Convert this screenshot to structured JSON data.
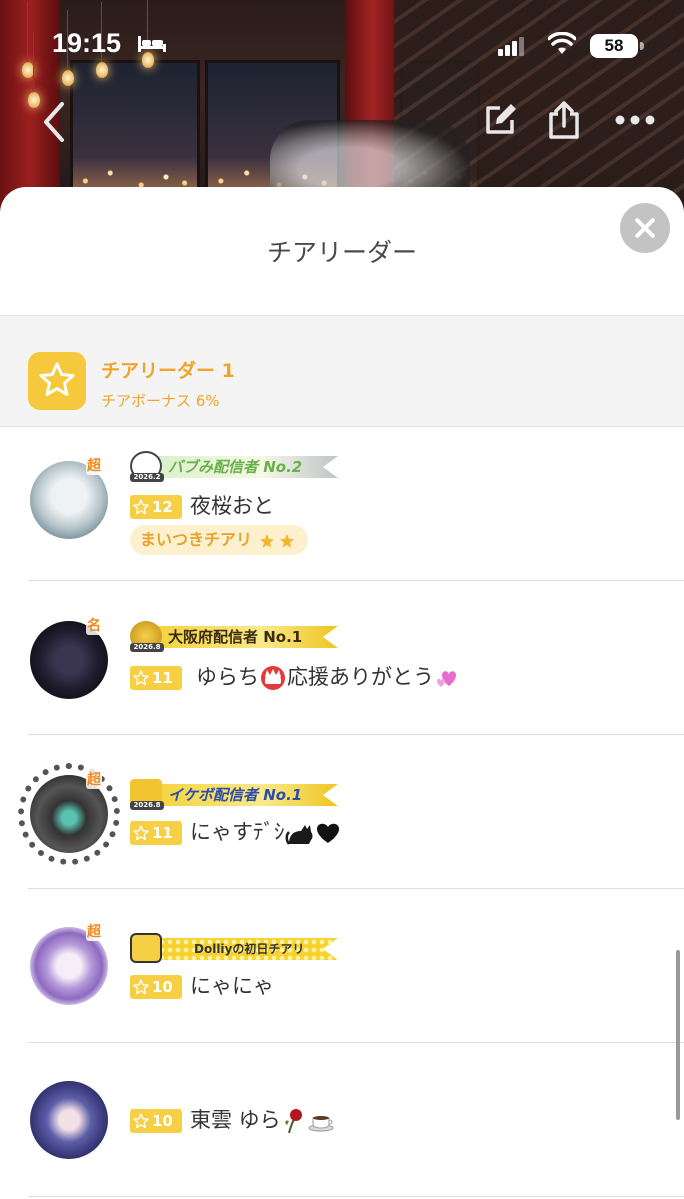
{
  "status_bar": {
    "time": "19:15",
    "battery": "58"
  },
  "sheet": {
    "title": "チアリーダー",
    "rank": {
      "title": "チアリーダー 1",
      "subtitle": "チアボーナス 6%"
    }
  },
  "users": [
    {
      "super_tag": "超",
      "badge": {
        "text": "バブみ配信者 No.2",
        "year": "2026.2",
        "style": "bubble"
      },
      "level": "12",
      "name": "夜桜おと",
      "pill": "まいつきチアリ"
    },
    {
      "super_tag": "名",
      "badge": {
        "text": "大阪府配信者 No.1",
        "year": "2026.8",
        "style": "gold"
      },
      "level": "11",
      "name": "ゆらち",
      "name_suffix": "応援ありがとう"
    },
    {
      "super_tag": "超",
      "badge": {
        "text": "イケボ配信者 No.1",
        "year": "2026.8",
        "style": "gold"
      },
      "level": "11",
      "name": "にゃすﾃﾞｼ"
    },
    {
      "super_tag": "超",
      "badge": {
        "text": "Dolliyの初日チアリ",
        "year": "",
        "style": "dots"
      },
      "level": "10",
      "name": "にゃにゃ"
    },
    {
      "super_tag": "",
      "level": "10",
      "name": "東雲 ゆら"
    }
  ],
  "colors": {
    "accent": "#eea52a",
    "chip": "#f6cf44",
    "pill_bg": "#fdf0cf"
  },
  "icons": [
    "sleep-icon",
    "signal-icon",
    "wifi-icon",
    "back-chevron-icon",
    "edit-icon",
    "share-icon",
    "more-icon",
    "close-icon",
    "star-icon"
  ]
}
